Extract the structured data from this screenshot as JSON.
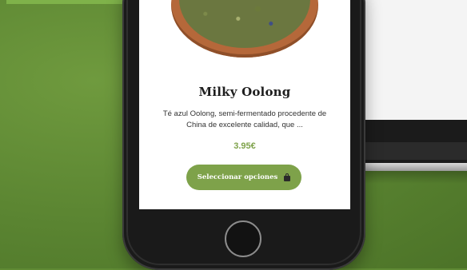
{
  "product": {
    "title": "Milky Oolong",
    "description": "Té azul Oolong, semi-fermentado procedente de China de excelente calidad, que ...",
    "price": "3.95€",
    "button_label": "Seleccionar opciones",
    "button_icon": "shopping-bag-icon"
  },
  "colors": {
    "accent": "#7ea24a",
    "background": "#5f8a34",
    "phone_body": "#1a1a1a"
  }
}
